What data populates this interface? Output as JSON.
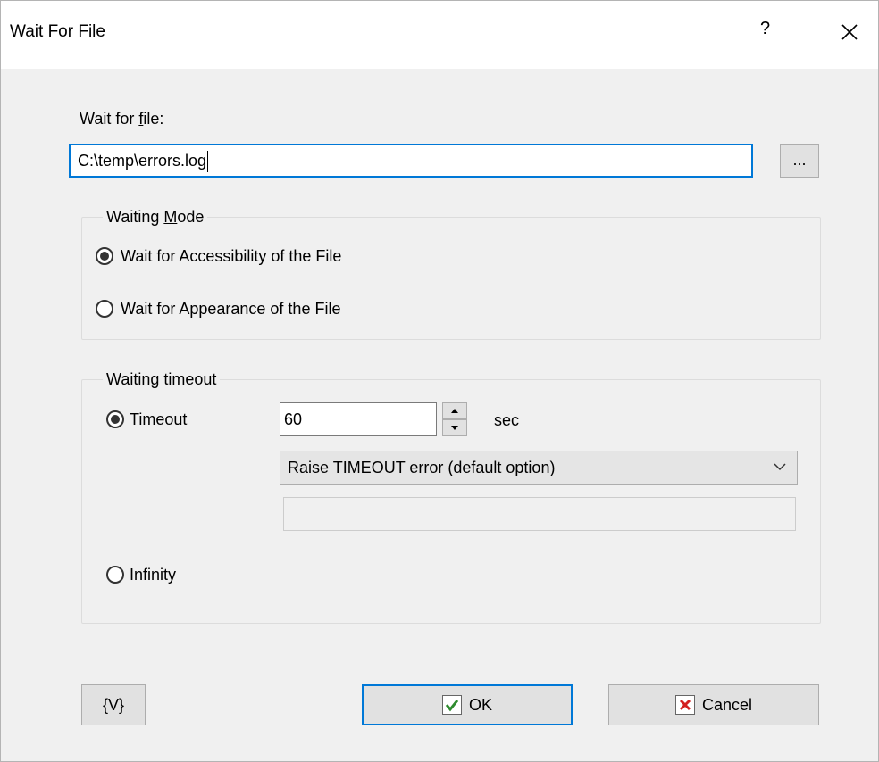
{
  "window": {
    "title": "Wait For File",
    "help": "?"
  },
  "file": {
    "label_prefix": "Wait for ",
    "label_access_key": "f",
    "label_suffix": "ile:",
    "value": "C:\\temp\\errors.log",
    "browse_label": "..."
  },
  "waiting_mode": {
    "title_prefix": "Waiting ",
    "title_access_key": "M",
    "title_suffix": "ode",
    "options": [
      {
        "label": "Wait for Accessibility of the File",
        "checked": true
      },
      {
        "label": "Wait for Appearance of the File",
        "checked": false
      }
    ]
  },
  "timeout": {
    "title": "Waiting timeout",
    "timeout_label": "Timeout",
    "timeout_checked": true,
    "value": "60",
    "unit": "sec",
    "action_selected": "Raise TIMEOUT error (default option)",
    "message_value": "",
    "infinity_label": "Infinity",
    "infinity_checked": false
  },
  "buttons": {
    "variables": "{V}",
    "ok": "OK",
    "cancel": "Cancel"
  },
  "icons": {
    "ok": "checkmark-icon",
    "cancel": "cross-icon",
    "close": "close-icon",
    "dropdown": "chevron-down-icon"
  },
  "colors": {
    "focus": "#0078d7",
    "ok_check": "#2e8b2e",
    "cancel_cross": "#d32020"
  }
}
